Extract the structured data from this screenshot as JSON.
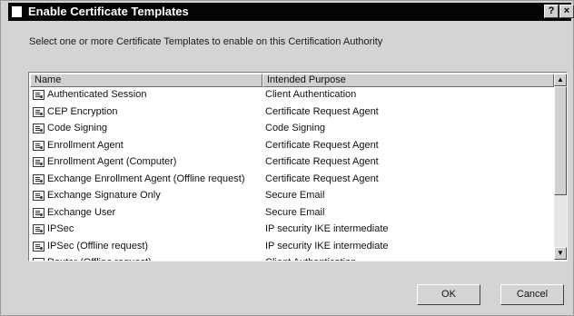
{
  "window": {
    "title": "Enable Certificate Templates",
    "help_glyph": "?",
    "close_glyph": "×"
  },
  "prompt": "Select one or more Certificate Templates to enable on this Certification Authority",
  "list": {
    "columns": [
      "Name",
      "Intended Purpose"
    ],
    "rows": [
      {
        "name": "Authenticated Session",
        "purpose": "Client Authentication"
      },
      {
        "name": "CEP Encryption",
        "purpose": "Certificate Request Agent"
      },
      {
        "name": "Code Signing",
        "purpose": "Code Signing"
      },
      {
        "name": "Enrollment Agent",
        "purpose": "Certificate Request Agent"
      },
      {
        "name": "Enrollment Agent (Computer)",
        "purpose": "Certificate Request Agent"
      },
      {
        "name": "Exchange Enrollment Agent (Offline request)",
        "purpose": "Certificate Request Agent"
      },
      {
        "name": "Exchange Signature Only",
        "purpose": "Secure Email"
      },
      {
        "name": "Exchange User",
        "purpose": "Secure Email"
      },
      {
        "name": "IPSec",
        "purpose": "IP security IKE intermediate"
      },
      {
        "name": "IPSec (Offline request)",
        "purpose": "IP security IKE intermediate"
      },
      {
        "name": "Router (Offline request)",
        "purpose": "Client Authentication"
      }
    ]
  },
  "scrollbar": {
    "up_glyph": "▲",
    "down_glyph": "▼"
  },
  "buttons": {
    "ok": "OK",
    "cancel": "Cancel"
  }
}
